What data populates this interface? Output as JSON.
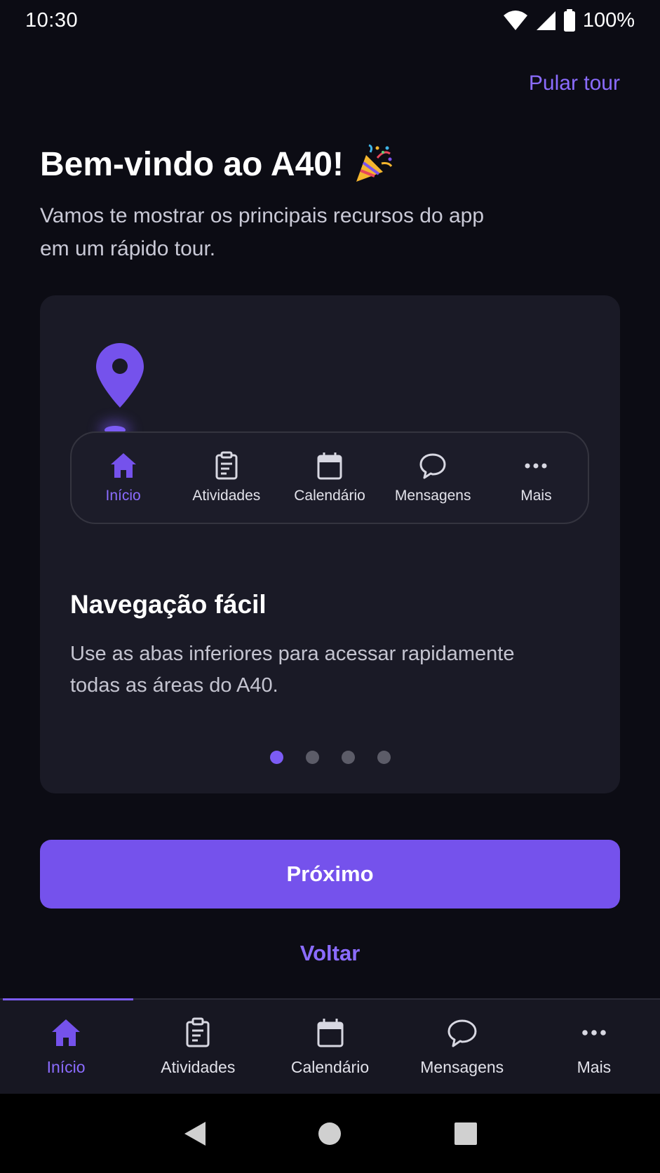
{
  "status_bar": {
    "time": "10:30",
    "battery": "100%"
  },
  "header": {
    "skip_label": "Pular tour"
  },
  "welcome": {
    "title": "Bem-vindo ao A40!",
    "subtitle": "Vamos te mostrar os principais recursos do app em um rápido tour."
  },
  "card": {
    "mini_nav": [
      {
        "label": "Início",
        "icon": "home-icon",
        "active": true
      },
      {
        "label": "Atividades",
        "icon": "clipboard-icon",
        "active": false
      },
      {
        "label": "Calendário",
        "icon": "calendar-icon",
        "active": false
      },
      {
        "label": "Mensagens",
        "icon": "chat-icon",
        "active": false
      },
      {
        "label": "Mais",
        "icon": "more-icon",
        "active": false
      }
    ],
    "feature_title": "Navegação fácil",
    "feature_desc": "Use as abas inferiores para acessar rapidamente todas as áreas do A40.",
    "page_count": 4,
    "current_page": 1
  },
  "actions": {
    "next_label": "Próximo",
    "back_label": "Voltar"
  },
  "bottom_nav": [
    {
      "label": "Início",
      "icon": "home-icon",
      "active": true
    },
    {
      "label": "Atividades",
      "icon": "clipboard-icon",
      "active": false
    },
    {
      "label": "Calendário",
      "icon": "calendar-icon",
      "active": false
    },
    {
      "label": "Mensagens",
      "icon": "chat-icon",
      "active": false
    },
    {
      "label": "Mais",
      "icon": "more-icon",
      "active": false
    }
  ],
  "colors": {
    "accent": "#7552ec",
    "accent_text": "#8b6cff",
    "background": "#0c0c14",
    "card": "#1a1a26"
  }
}
